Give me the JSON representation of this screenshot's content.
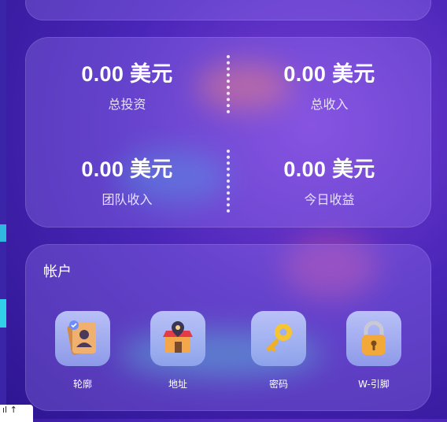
{
  "stats": [
    {
      "value": "0.00 美元",
      "label": "总投资"
    },
    {
      "value": "0.00 美元",
      "label": "总收入"
    },
    {
      "value": "0.00 美元",
      "label": "团队收入"
    },
    {
      "value": "0.00 美元",
      "label": "今日收益"
    }
  ],
  "account": {
    "title": "帐户",
    "items": [
      {
        "label": "轮廓",
        "icon": "profile-card-icon"
      },
      {
        "label": "地址",
        "icon": "shop-location-icon"
      },
      {
        "label": "密码",
        "icon": "key-icon"
      },
      {
        "label": "W-引脚",
        "icon": "padlock-icon"
      }
    ]
  },
  "bottom_tab": {
    "label": "ıl ↑"
  }
}
